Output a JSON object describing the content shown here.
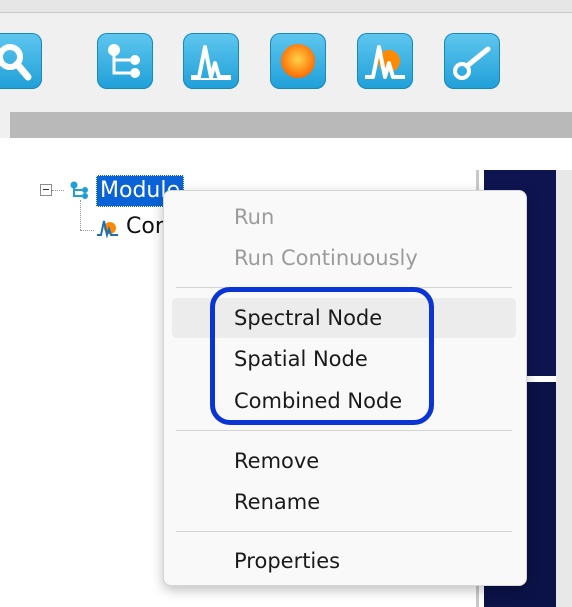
{
  "toolbar": {
    "buttons": [
      {
        "icon": "search-icon"
      },
      {
        "icon": "module-tree-icon"
      },
      {
        "icon": "spectral-peak-icon"
      },
      {
        "icon": "spatial-circle-icon"
      },
      {
        "icon": "combined-node-icon"
      },
      {
        "icon": "key-icon"
      }
    ],
    "accent": "#1f9fd8"
  },
  "tree": {
    "root_label": "Module",
    "child_label": "Cor"
  },
  "context_menu": {
    "items": [
      {
        "label": "Run",
        "enabled": false
      },
      {
        "label": "Run Continuously",
        "enabled": false
      },
      {
        "label": "Spectral Node",
        "enabled": true
      },
      {
        "label": "Spatial Node",
        "enabled": true
      },
      {
        "label": "Combined Node",
        "enabled": true
      },
      {
        "label": "Remove",
        "enabled": true
      },
      {
        "label": "Rename",
        "enabled": true
      },
      {
        "label": "Properties",
        "enabled": true
      }
    ],
    "highlight_color": "#0a34d4"
  }
}
